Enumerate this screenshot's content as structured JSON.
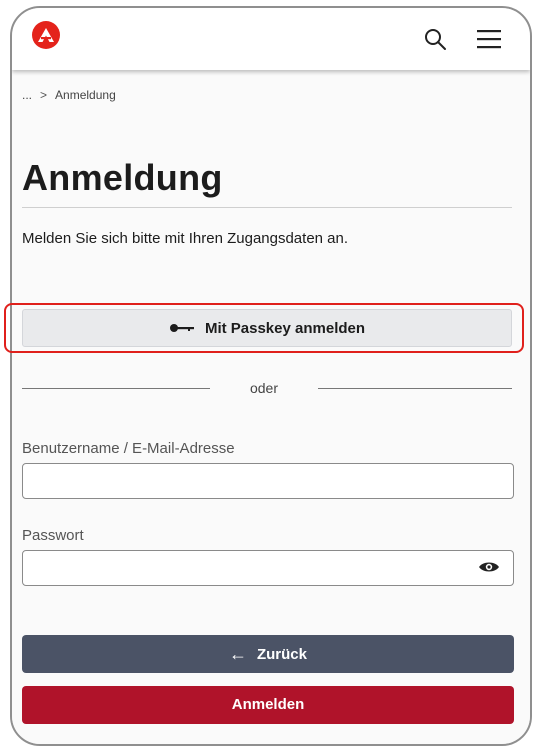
{
  "header": {
    "logo_icon": "agency-logo-icon",
    "brand_color": "#e4231b",
    "search_icon": "search-icon",
    "menu_icon": "hamburger-menu-icon"
  },
  "breadcrumb": {
    "ellipsis": "...",
    "separator": ">",
    "current": "Anmeldung"
  },
  "page": {
    "title": "Anmeldung",
    "subtitle": "Melden Sie sich bitte mit Ihren Zugangsdaten an."
  },
  "passkey": {
    "label": "Mit Passkey anmelden",
    "icon": "key-icon",
    "highlight_color": "#e0201c"
  },
  "divider_text": "oder",
  "form": {
    "username_label": "Benutzername / E-Mail-Adresse",
    "username_value": "",
    "password_label": "Passwort",
    "password_value": "",
    "eye_icon": "show-password-icon"
  },
  "buttons": {
    "back_label": "Zurück",
    "back_arrow": "←",
    "back_color": "#4b5366",
    "login_label": "Anmelden",
    "login_color": "#b0132a"
  }
}
